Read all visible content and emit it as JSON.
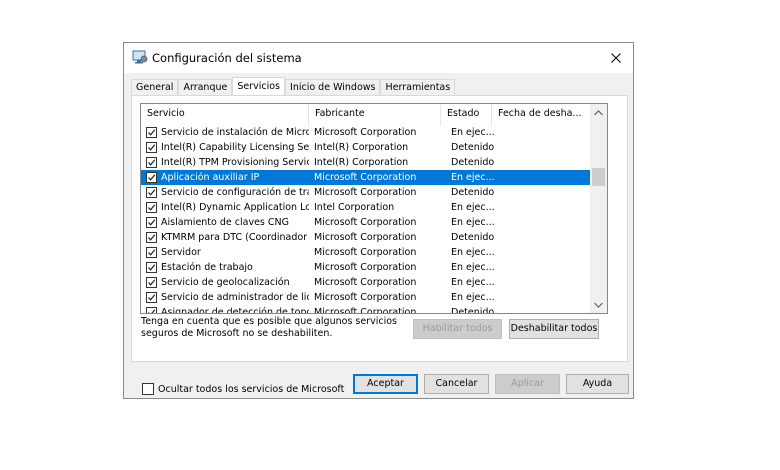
{
  "window": {
    "title": "Configuración del sistema",
    "icon": "system-config-icon"
  },
  "tabs": [
    {
      "label": "General",
      "active": false
    },
    {
      "label": "Arranque",
      "active": false
    },
    {
      "label": "Servicios",
      "active": true
    },
    {
      "label": "Inicio de Windows",
      "active": false
    },
    {
      "label": "Herramientas",
      "active": false
    }
  ],
  "columns": {
    "servicio": "Servicio",
    "fabricante": "Fabricante",
    "estado": "Estado",
    "fecha": "Fecha de desha..."
  },
  "services": [
    {
      "name": "Servicio de instalación de Micro...",
      "vendor": "Microsoft Corporation",
      "status": "En ejec...",
      "checked": true
    },
    {
      "name": "Intel(R) Capability Licensing Ser...",
      "vendor": "Intel(R) Corporation",
      "status": "Detenido",
      "checked": true
    },
    {
      "name": "Intel(R) TPM Provisioning Service",
      "vendor": "Intel(R) Corporation",
      "status": "Detenido",
      "checked": true
    },
    {
      "name": "Aplicación auxiliar IP",
      "vendor": "Microsoft Corporation",
      "status": "En ejec...",
      "checked": true,
      "selected": true
    },
    {
      "name": "Servicio de configuración de tra...",
      "vendor": "Microsoft Corporation",
      "status": "Detenido",
      "checked": true
    },
    {
      "name": "Intel(R) Dynamic Application Loa...",
      "vendor": "Intel Corporation",
      "status": "En ejec...",
      "checked": true
    },
    {
      "name": "Aislamiento de claves CNG",
      "vendor": "Microsoft Corporation",
      "status": "En ejec...",
      "checked": true
    },
    {
      "name": "KTMRM para DTC (Coordinador ...",
      "vendor": "Microsoft Corporation",
      "status": "Detenido",
      "checked": true
    },
    {
      "name": "Servidor",
      "vendor": "Microsoft Corporation",
      "status": "En ejec...",
      "checked": true
    },
    {
      "name": "Estación de trabajo",
      "vendor": "Microsoft Corporation",
      "status": "En ejec...",
      "checked": true
    },
    {
      "name": "Servicio de geolocalización",
      "vendor": "Microsoft Corporation",
      "status": "En ejec...",
      "checked": true
    },
    {
      "name": "Servicio de administrador de lic...",
      "vendor": "Microsoft Corporation",
      "status": "En ejec...",
      "checked": true
    },
    {
      "name": "Asignador de detección de topol...",
      "vendor": "Microsoft Corporation",
      "status": "Detenido",
      "checked": true
    }
  ],
  "note": "Tenga en cuenta que es posible que algunos servicios seguros de Microsoft no se deshabiliten.",
  "buttons": {
    "enable_all": "Habilitar todos",
    "disable_all": "Deshabilitar todos",
    "ok": "Aceptar",
    "cancel": "Cancelar",
    "apply": "Aplicar",
    "help": "Ayuda"
  },
  "hide_ms": {
    "label": "Ocultar todos los servicios de Microsoft",
    "checked": false
  },
  "colors": {
    "selection": "#0078d7",
    "window_bg": "#f0f0f0"
  }
}
